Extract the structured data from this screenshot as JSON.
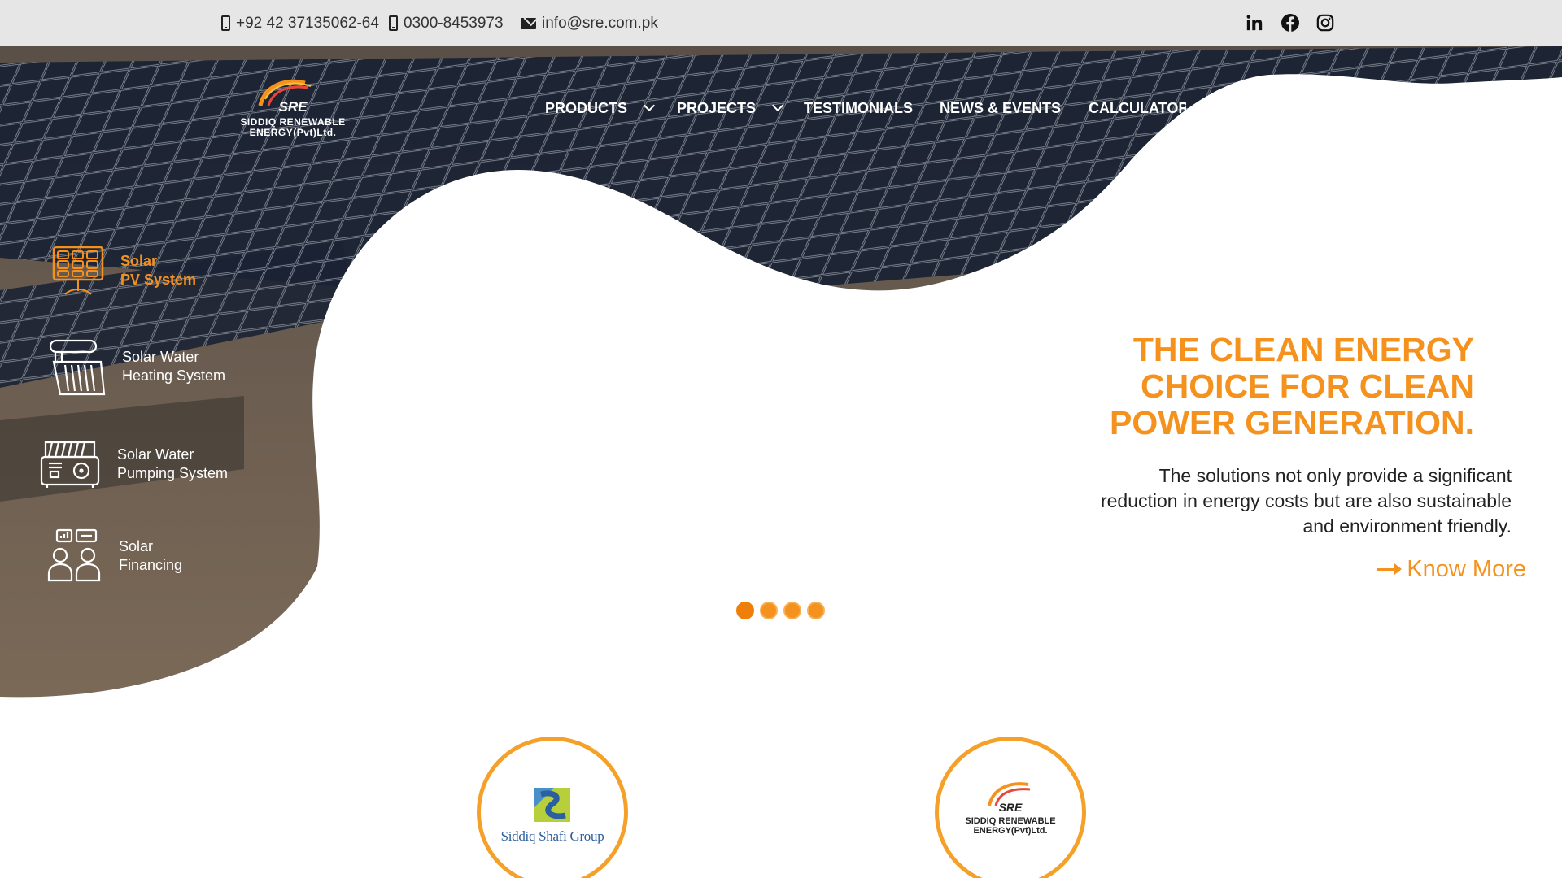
{
  "topbar": {
    "phone1": "+92 42 37135062-64",
    "phone2": "0300-8453973",
    "email": "info@sre.com.pk",
    "social_icons": [
      "linkedin-icon",
      "facebook-icon",
      "instagram-icon"
    ]
  },
  "logo": {
    "abbr": "SRE",
    "name_line1": "SIDDIQ RENEWABLE",
    "name_line2": "ENERGY(Pvt)Ltd."
  },
  "nav": {
    "products": "PRODUCTS",
    "projects": "PROJECTS",
    "testimonials": "TESTIMONIALS",
    "news": "NEWS & EVENTS",
    "calculator": "CALCULATOR"
  },
  "sidebar": {
    "items": [
      {
        "line1": "Solar",
        "line2": "PV System",
        "icon": "solar-panel-icon",
        "active": true
      },
      {
        "line1": "Solar Water",
        "line2": "Heating System",
        "icon": "water-heater-icon",
        "active": false
      },
      {
        "line1": "Solar Water",
        "line2": "Pumping System",
        "icon": "pump-icon",
        "active": false
      },
      {
        "line1": "Solar",
        "line2": "Financing",
        "icon": "financing-people-icon",
        "active": false
      }
    ]
  },
  "hero": {
    "headline_line1": "THE CLEAN ENERGY",
    "headline_line2": "CHOICE FOR CLEAN",
    "headline_line3": "POWER GENERATION.",
    "description_line1": "The solutions not only provide a significant",
    "description_line2": "reduction in energy costs but are also sustainable",
    "description_line3": "and environment friendly.",
    "cta": "Know More"
  },
  "slider": {
    "count": 4,
    "active_index": 0
  },
  "partners": {
    "group_name": "Siddiq Shafi Group",
    "sre_abbr": "SRE",
    "sre_line1": "SIDDIQ RENEWABLE",
    "sre_line2": "ENERGY(Pvt)Ltd."
  },
  "colors": {
    "accent": "#f5921e",
    "topbar": "#e6e6e6"
  }
}
